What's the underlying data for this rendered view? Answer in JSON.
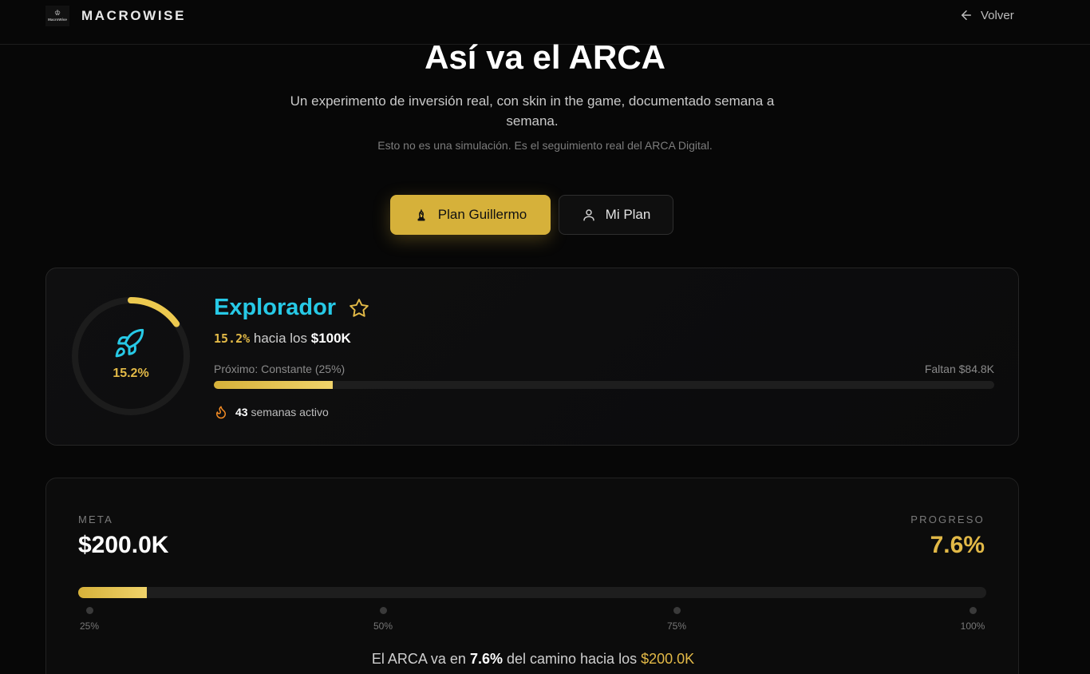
{
  "header": {
    "logo_text": "MacroWise",
    "brand": "MACROWISE",
    "back_label": "Volver"
  },
  "hero": {
    "title": "Así va el ARCA",
    "subtitle": "Un experimento de inversión real, con skin in the game, documentado semana a semana.",
    "note": "Esto no es una simulación. Es el seguimiento real del ARCA Digital."
  },
  "plans": {
    "primary_label": "Plan Guillermo",
    "secondary_label": "Mi Plan"
  },
  "level_card": {
    "ring_percent_label": "15.2%",
    "ring_progress": 0.152,
    "level_name": "Explorador",
    "percent": "15.2%",
    "toward_text": "hacia los",
    "target": "$100K",
    "next_label": "Próximo: Constante (25%)",
    "remaining": "Faltan $84.8K",
    "bar_progress": 0.152,
    "streak_weeks": "43",
    "streak_suffix": "semanas activo"
  },
  "goal_card": {
    "meta_label": "META",
    "meta_value": "$200.0K",
    "progress_label": "PROGRESO",
    "progress_value": "7.6%",
    "bar_progress": 0.076,
    "milestones": [
      "25%",
      "50%",
      "75%",
      "100%"
    ],
    "summary_prefix": "El ARCA va en",
    "summary_percent": "7.6%",
    "summary_middle": "del camino hacia los",
    "summary_target": "$200.0K"
  },
  "colors": {
    "accent_gold": "#d6b13a",
    "level_cyan": "#27c9e6",
    "background": "#070707"
  },
  "icons": [
    "logo-icon",
    "arrow-left-icon",
    "chess-bishop-icon",
    "user-icon",
    "rocket-icon",
    "star-icon",
    "flame-icon"
  ]
}
